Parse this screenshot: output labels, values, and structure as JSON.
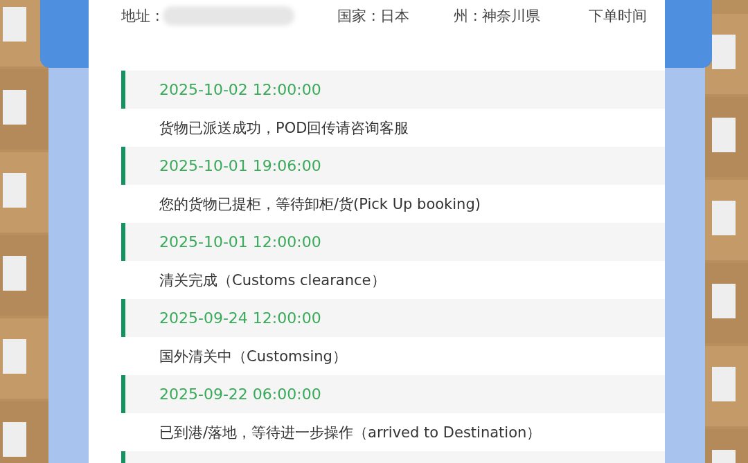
{
  "info_fields": [
    {
      "label": "地址 :",
      "redacted": true
    },
    {
      "label": "国家 : 日本",
      "redacted": false
    },
    {
      "label": "州 : 神奈川県",
      "redacted": false
    },
    {
      "label": "下单时间",
      "redacted": false
    }
  ],
  "events": [
    {
      "time": "2025-10-02 12:00:00",
      "description": "货物已派送成功，POD回传请咨询客服"
    },
    {
      "time": "2025-10-01 19:06:00",
      "description": "您的货物已提柜，等待卸柜/货(Pick Up booking)"
    },
    {
      "time": "2025-10-01 12:00:00",
      "description": "清关完成（Customs clearance）"
    },
    {
      "time": "2025-09-24 12:00:00",
      "description": "国外清关中（Customsing）"
    },
    {
      "time": "2025-09-22 06:00:00",
      "description": "已到港/落地，等待进一步操作（arrived to Destination）"
    }
  ]
}
